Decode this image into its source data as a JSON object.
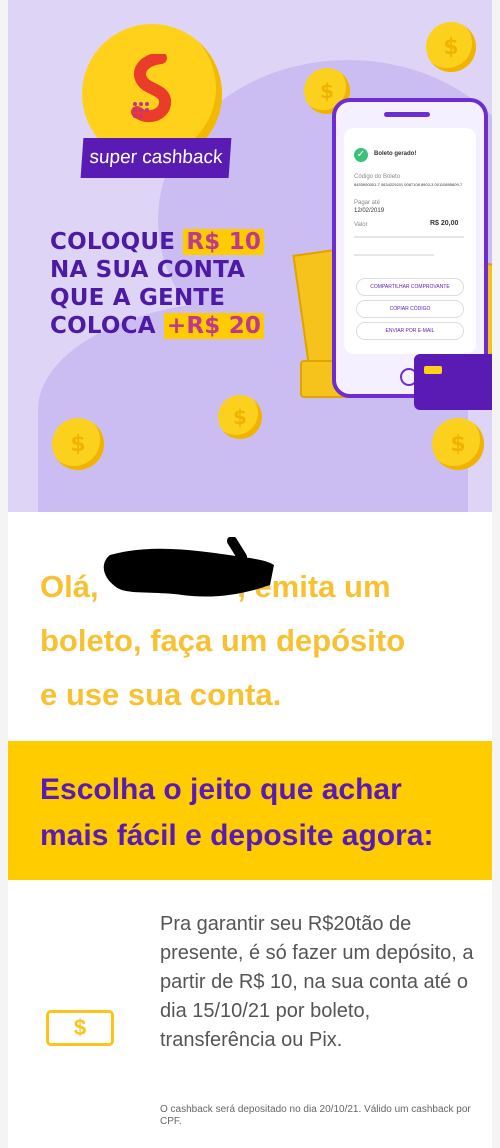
{
  "hero": {
    "logo_text": "super cashback",
    "headline": {
      "line1_pre": "COLOQUE ",
      "line1_highlight": "R$ 10",
      "line2": "NA SUA CONTA",
      "line3": "QUE A GENTE",
      "line4_pre": "COLOCA ",
      "line4_highlight": "+R$ 20"
    },
    "coin_symbol": "$",
    "phone": {
      "status": "Boleto gerado!",
      "code_label": "Código do Boleto",
      "code_value": "8453900001-7 0634229201 0087108 8903-3 00110895609-7",
      "due_label": "Pagar até",
      "due_value": "12/02/2019",
      "value_label": "Valor",
      "value": "R$ 20,00",
      "btn_share": "COMPARTILHAR COMPROVANTE",
      "btn_copy": "COPIAR CÓDIGO",
      "btn_email": "ENVIAR POR E-MAIL"
    }
  },
  "greeting": {
    "line1_pre": "Olá, ",
    "line1_post": ", emita um",
    "line2": "boleto, faça um depósito",
    "line3": "e use sua conta."
  },
  "band": {
    "line1": "Escolha o jeito que achar",
    "line2": "mais fácil e deposite agora:"
  },
  "deposit": {
    "icon": "dollar-bill-icon",
    "icon_symbol": "$",
    "text": "Pra garantir seu R$20tão de presente, é só fazer um depósito, a partir de R$ 10, na sua conta até o dia 15/10/21 por boleto, transferência ou Pix.",
    "note": "O cashback será depositado no dia 20/10/21. Válido um cashback por CPF."
  },
  "colors": {
    "purple": "#5a1bb5",
    "yellow": "#ffcc00",
    "lavender": "#ddd4f6",
    "greeting_yellow": "#f7c131"
  }
}
